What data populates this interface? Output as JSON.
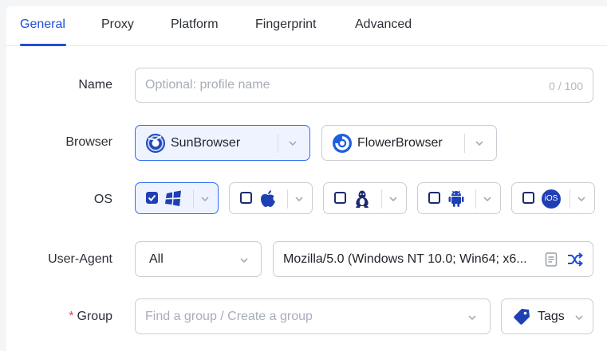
{
  "tabs": [
    {
      "label": "General",
      "active": true
    },
    {
      "label": "Proxy"
    },
    {
      "label": "Platform"
    },
    {
      "label": "Fingerprint"
    },
    {
      "label": "Advanced"
    }
  ],
  "form": {
    "name": {
      "label": "Name",
      "placeholder": "Optional: profile name",
      "counter": "0 / 100"
    },
    "browser": {
      "label": "Browser",
      "options": [
        {
          "name": "SunBrowser",
          "selected": true
        },
        {
          "name": "FlowerBrowser",
          "selected": false
        }
      ]
    },
    "os": {
      "label": "OS",
      "options": [
        {
          "icon": "windows-icon",
          "checked": true
        },
        {
          "icon": "apple-icon",
          "checked": false
        },
        {
          "icon": "linux-icon",
          "checked": false
        },
        {
          "icon": "android-icon",
          "checked": false
        },
        {
          "icon": "ios-icon",
          "checked": false,
          "badge": "iOS"
        }
      ]
    },
    "user_agent": {
      "label": "User-Agent",
      "filter": "All",
      "value": "Mozilla/5.0 (Windows NT 10.0; Win64; x6..."
    },
    "group": {
      "label": "Group",
      "required_mark": "*",
      "placeholder": "Find a group / Create a group",
      "tags_label": "Tags"
    }
  },
  "colors": {
    "accent": "#1f4fd6",
    "selected_bg": "#eef3ff",
    "required": "#e5484d"
  }
}
